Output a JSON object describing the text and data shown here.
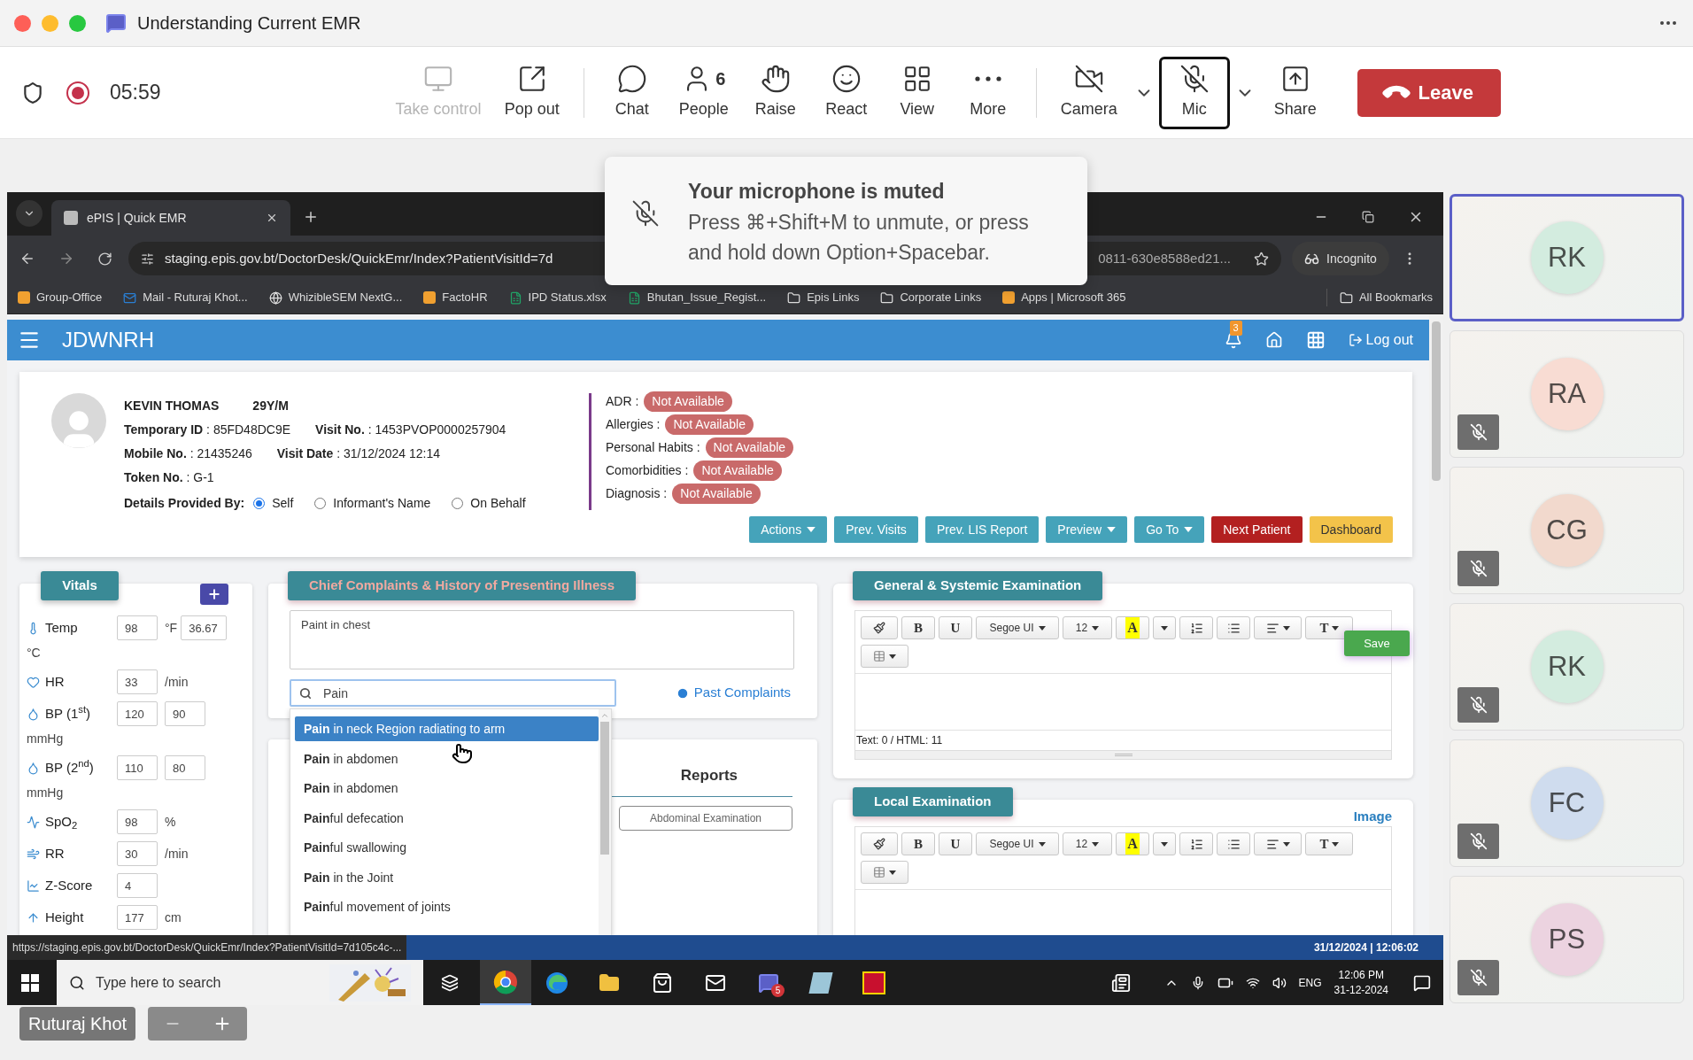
{
  "window": {
    "title": "Understanding Current EMR"
  },
  "meeting": {
    "timer": "05:59"
  },
  "toolbar": [
    {
      "label": "Take control",
      "disabled": true,
      "selected": false,
      "dropdown": false
    },
    {
      "label": "Pop out",
      "disabled": false,
      "selected": false,
      "dropdown": false
    },
    {
      "label": "Chat",
      "disabled": false,
      "selected": false,
      "dropdown": false
    },
    {
      "label": "People",
      "count": "6",
      "disabled": false,
      "selected": false,
      "dropdown": false
    },
    {
      "label": "Raise",
      "disabled": false,
      "selected": false,
      "dropdown": false
    },
    {
      "label": "React",
      "disabled": false,
      "selected": false,
      "dropdown": false
    },
    {
      "label": "View",
      "disabled": false,
      "selected": false,
      "dropdown": false
    },
    {
      "label": "More",
      "disabled": false,
      "selected": false,
      "dropdown": false
    },
    {
      "label": "Camera",
      "disabled": false,
      "selected": false,
      "dropdown": true
    },
    {
      "label": "Mic",
      "disabled": false,
      "selected": true,
      "dropdown": true
    },
    {
      "label": "Share",
      "disabled": false,
      "selected": false,
      "dropdown": false
    }
  ],
  "leave_button": "Leave",
  "toast": {
    "title": "Your microphone is muted",
    "message": "Press ⌘+Shift+M to unmute, or press and hold down Option+Spacebar."
  },
  "browser": {
    "tab": "ePIS | Quick EMR",
    "address_start": "staging.epis.gov.bt/DoctorDesk/QuickEmr/Index?PatientVisitId=7d",
    "address_end": "0811-630e8588ed21...",
    "incognito": "Incognito",
    "bookmarks": [
      {
        "kind": "site",
        "label": "Group-Office"
      },
      {
        "kind": "mail",
        "label": "Mail - Ruturaj Khot..."
      },
      {
        "kind": "globe",
        "label": "WhizibleSEM NextG..."
      },
      {
        "kind": "site",
        "label": "FactoHR"
      },
      {
        "kind": "sheet",
        "label": "IPD Status.xlsx"
      },
      {
        "kind": "sheet",
        "label": "Bhutan_Issue_Regist..."
      },
      {
        "kind": "folder",
        "label": "Epis Links"
      },
      {
        "kind": "folder",
        "label": "Corporate Links"
      },
      {
        "kind": "site",
        "label": "Apps | Microsoft 365"
      }
    ],
    "all_bookmarks": "All Bookmarks"
  },
  "app": {
    "brand": "JDWNRH",
    "notifications": "3",
    "logout": "Log out"
  },
  "patient": {
    "name": "KEVIN THOMAS",
    "age": "29Y/M",
    "rows": [
      [
        {
          "label": "Temporary ID",
          "value": ": 85FD48DC9E"
        },
        {
          "label": "Visit No.",
          "value": ": 1453PVOP0000257904"
        }
      ],
      [
        {
          "label": "Mobile No.",
          "value": ": 21435246"
        },
        {
          "label": "Visit Date",
          "value": ": 31/12/2024 12:14"
        }
      ],
      [
        {
          "label": "Token No.",
          "value": ": G-1"
        }
      ]
    ],
    "provided_by_label": "Details Provided By:",
    "provided_by": [
      {
        "label": "Self",
        "selected": true
      },
      {
        "label": "Informant's Name",
        "selected": false
      },
      {
        "label": "On Behalf",
        "selected": false
      }
    ],
    "alerts": [
      {
        "label": "ADR :",
        "value": "Not Available"
      },
      {
        "label": "Allergies :",
        "value": "Not Available"
      },
      {
        "label": "Personal Habits :",
        "value": "Not Available"
      },
      {
        "label": "Comorbidities :",
        "value": "Not Available"
      },
      {
        "label": "Diagnosis :",
        "value": "Not Available"
      }
    ],
    "actions": [
      {
        "label": "Actions",
        "kind": "info",
        "dropdown": true
      },
      {
        "label": "Prev. Visits",
        "kind": "info",
        "dropdown": false
      },
      {
        "label": "Prev. LIS Report",
        "kind": "info",
        "dropdown": false
      },
      {
        "label": "Preview",
        "kind": "info",
        "dropdown": true
      },
      {
        "label": "Go To",
        "kind": "info",
        "dropdown": true
      },
      {
        "label": "Next Patient",
        "kind": "danger",
        "dropdown": false
      },
      {
        "label": "Dashboard",
        "kind": "warning",
        "dropdown": false
      }
    ]
  },
  "vitals": {
    "title": "Vitals",
    "rows": [
      {
        "label": "Temp",
        "fields": [
          {
            "value": "98",
            "unit": "°F"
          },
          {
            "value": "36.67"
          }
        ],
        "unit_below": "°C"
      },
      {
        "label": "HR",
        "fields": [
          {
            "value": "33",
            "unit": "/min"
          }
        ]
      },
      {
        "label": "BP (1$^{st}$)",
        "fields": [
          {
            "value": "120"
          },
          {
            "value": "90"
          }
        ],
        "unit_below": "mmHg"
      },
      {
        "label": "BP (2$^{nd}$)",
        "fields": [
          {
            "value": "110"
          },
          {
            "value": "80"
          }
        ],
        "unit_below": "mmHg"
      },
      {
        "label": "SpO$_{2}$",
        "fields": [
          {
            "value": "98",
            "unit": "%"
          }
        ]
      },
      {
        "label": "RR",
        "fields": [
          {
            "value": "30",
            "unit": "/min"
          }
        ]
      },
      {
        "label": "Z-Score",
        "fields": [
          {
            "value": "4"
          }
        ]
      },
      {
        "label": "Height",
        "fields": [
          {
            "value": "177",
            "unit": "cm"
          }
        ]
      }
    ]
  },
  "complaints": {
    "title": "Chief Complaints & History of Presenting Illness",
    "text": "Paint in chest",
    "search": "Pain",
    "past_link": "Past Complaints",
    "suggestions": [
      {
        "text": "**Pain** in neck Region radiating to arm",
        "selected": true
      },
      {
        "text": "**Pain** in abdomen",
        "selected": false
      },
      {
        "text": "**Pain** in abdomen",
        "selected": false
      },
      {
        "text": "**Pain**ful defecation",
        "selected": false
      },
      {
        "text": "**Pain**ful swallowing",
        "selected": false
      },
      {
        "text": "**Pain** in the Joint",
        "selected": false
      },
      {
        "text": "**Pain**ful movement of joints",
        "selected": false
      }
    ]
  },
  "reports": {
    "title": "Reports",
    "item": "Abdominal Examination"
  },
  "general_exam": {
    "title": "General & Systemic Examination",
    "save": "Save",
    "footer": "Text: 0 / HTML: 11",
    "tools": [
      {
        "kind": "brush"
      },
      {
        "kind": "letter",
        "label": "B"
      },
      {
        "kind": "letter",
        "label": "U"
      },
      {
        "kind": "select",
        "label": "Segoe UI"
      },
      {
        "kind": "select",
        "label": "12"
      },
      {
        "kind": "highlight",
        "label": "A"
      },
      {
        "kind": "caret"
      },
      {
        "kind": "ol"
      },
      {
        "kind": "ul"
      },
      {
        "kind": "align"
      },
      {
        "kind": "size",
        "label": "T"
      },
      {
        "kind": "table"
      }
    ]
  },
  "local_exam": {
    "title": "Local Examination",
    "image_link": "Image",
    "tools": [
      {
        "kind": "brush"
      },
      {
        "kind": "letter",
        "label": "B"
      },
      {
        "kind": "letter",
        "label": "U"
      },
      {
        "kind": "select",
        "label": "Segoe UI"
      },
      {
        "kind": "select",
        "label": "12"
      },
      {
        "kind": "highlight",
        "label": "A"
      },
      {
        "kind": "caret"
      },
      {
        "kind": "ol"
      },
      {
        "kind": "ul"
      },
      {
        "kind": "align"
      },
      {
        "kind": "size",
        "label": "T"
      },
      {
        "kind": "table"
      }
    ]
  },
  "status_bar": {
    "url": "https://staging.epis.gov.bt/DoctorDesk/QuickEmr/Index?PatientVisitId=7d105c4c-...",
    "datetime": "31/12/2024 | 12:06:02"
  },
  "taskbar": {
    "search_placeholder": "Type here to search",
    "teams_badge": "5",
    "language": "ENG",
    "time": "12:06 PM",
    "date": "31-12-2024"
  },
  "presenter": {
    "name": "Ruturaj Khot"
  },
  "participants": [
    {
      "initials": "RK",
      "color": "#d3ecdf",
      "muted": false,
      "selected": true
    },
    {
      "initials": "RA",
      "color": "#f8dcd3",
      "muted": true,
      "selected": false
    },
    {
      "initials": "CG",
      "color": "#f2d9cd",
      "muted": true,
      "selected": false
    },
    {
      "initials": "RK",
      "color": "#d3ecdf",
      "muted": true,
      "selected": false
    },
    {
      "initials": "FC",
      "color": "#cfdcee",
      "muted": true,
      "selected": false
    },
    {
      "initials": "PS",
      "color": "#ecd3e0",
      "muted": true,
      "selected": false
    }
  ]
}
